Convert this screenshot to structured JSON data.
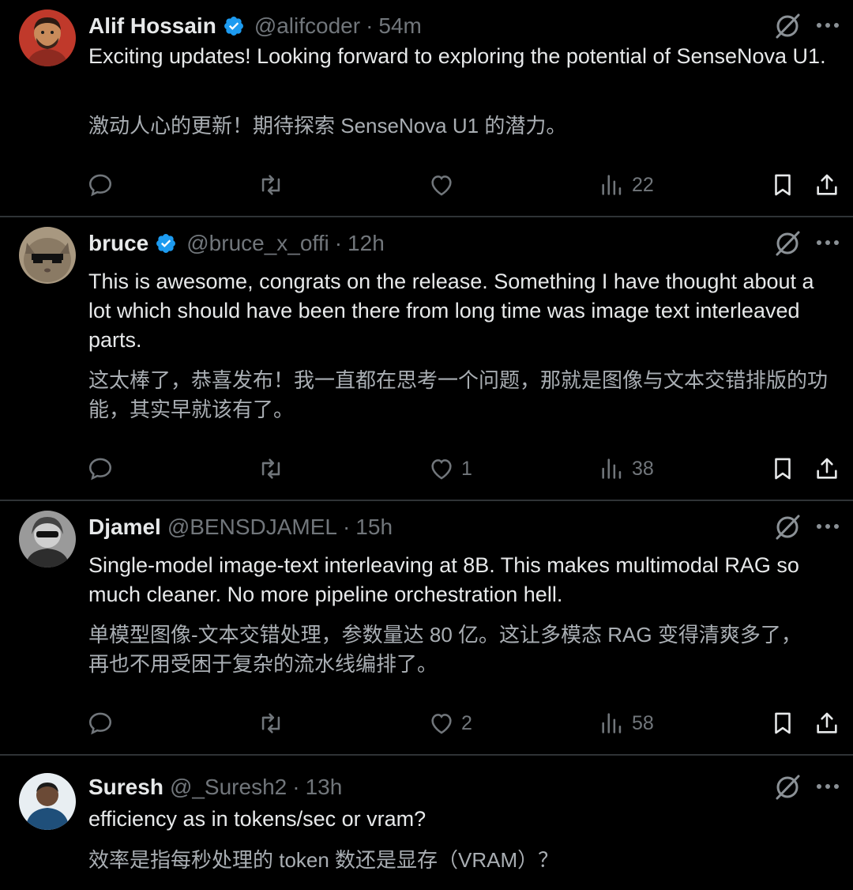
{
  "posts": [
    {
      "name": "Alif Hossain",
      "verified": true,
      "handle": "@alifcoder",
      "separator": "·",
      "time": "54m",
      "text_en": "Exciting updates! Looking forward to exploring the potential of SenseNova U1.",
      "text_zh": "激动人心的更新！期待探索 SenseNova U1 的潜力。",
      "likes": "",
      "views": "22"
    },
    {
      "name": "bruce",
      "verified": true,
      "handle": "@bruce_x_offi",
      "separator": "·",
      "time": "12h",
      "text_en": "This is awesome, congrats on the release. Something I have thought about a lot which should have been there from long time was image text interleaved parts.",
      "text_zh": "这太棒了，恭喜发布！我一直都在思考一个问题，那就是图像与文本交错排版的功能，其实早就该有了。",
      "likes": "1",
      "views": "38"
    },
    {
      "name": "Djamel",
      "verified": false,
      "handle": "@BENSDJAMEL",
      "separator": "·",
      "time": "15h",
      "text_en": "Single-model image-text interleaving at 8B. This makes multimodal RAG so much cleaner. No more pipeline orchestration hell.",
      "text_zh": "单模型图像-文本交错处理，参数量达 80 亿。这让多模态 RAG 变得清爽多了，再也不用受困于复杂的流水线编排了。",
      "likes": "2",
      "views": "58"
    },
    {
      "name": "Suresh",
      "verified": false,
      "handle": "@_Suresh2",
      "separator": "·",
      "time": "13h",
      "text_en": "efficiency as in tokens/sec or vram?",
      "text_zh": "效率是指每秒处理的 token 数还是显存（VRAM）？",
      "likes": "",
      "views": ""
    }
  ],
  "colors": {
    "background": "#000000",
    "text": "#e7e9ea",
    "muted": "#71767b",
    "verified": "#1d9bf0",
    "divider": "#2f3336"
  },
  "icons": [
    "grok-icon",
    "more-icon",
    "reply-icon",
    "repost-icon",
    "like-icon",
    "views-icon",
    "bookmark-icon",
    "share-icon",
    "verified-badge-icon"
  ]
}
